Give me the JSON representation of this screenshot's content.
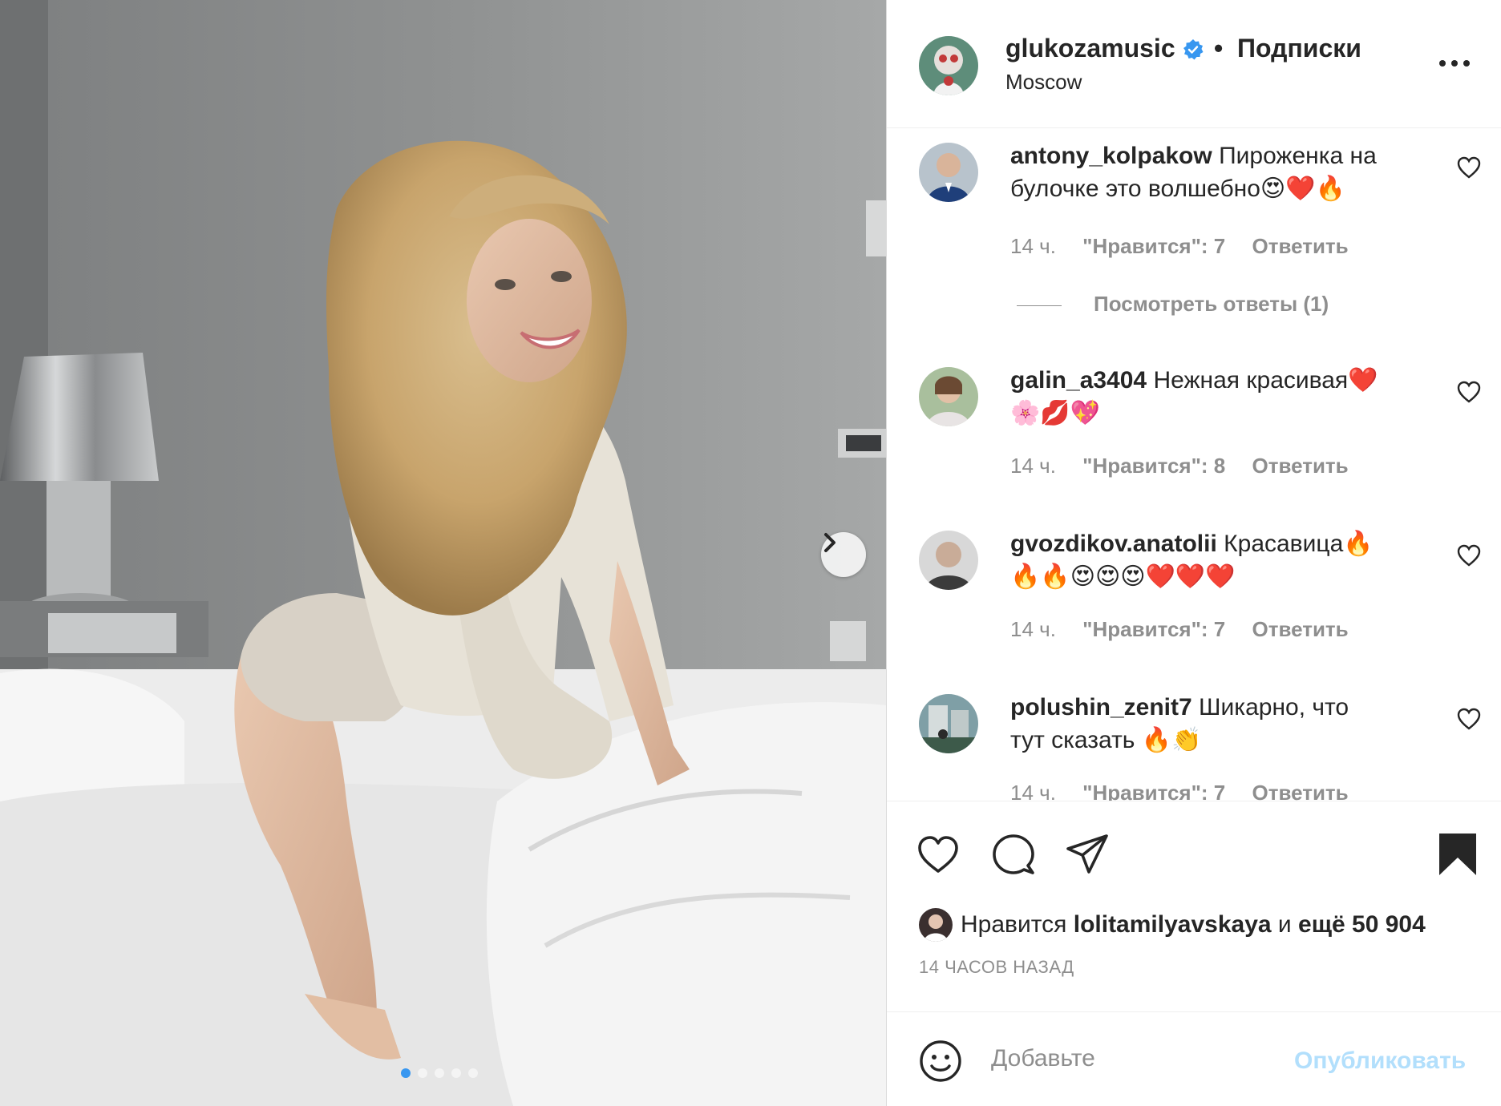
{
  "colors": {
    "accent": "#3897f0",
    "muted": "#8e8e8e",
    "text": "#262626",
    "publish_disabled": "#b2dffc"
  },
  "photo": {
    "carousel_total": 5,
    "carousel_active": 1
  },
  "header": {
    "username": "glukozamusic",
    "verified_icon": "verified-badge-icon",
    "separator": "•",
    "follow_label": "Подписки",
    "location": "Moscow"
  },
  "comments": [
    {
      "username": "antony_kolpakow",
      "text": "Пироженка на булочке это волшебно😍❤️🔥",
      "time": "14 ч.",
      "likes": "\"Нравится\": 7",
      "reply": "Ответить"
    },
    {
      "username": "galin_a3404",
      "text": "Нежная красивая❤️🌸💋💖",
      "time": "14 ч.",
      "likes": "\"Нравится\": 8",
      "reply": "Ответить"
    },
    {
      "username": "gvozdikov.anatolii",
      "text": "Красавица🔥🔥🔥😍😍😍❤️❤️❤️",
      "time": "14 ч.",
      "likes": "\"Нравится\": 7",
      "reply": "Ответить"
    },
    {
      "username": "polushin_zenit7",
      "text": "Шикарно, что тут сказать 🔥👏",
      "time": "14 ч.",
      "likes": "\"Нравится\": 7",
      "reply": "Ответить"
    }
  ],
  "view_replies": "Посмотреть ответы (1)",
  "likes": {
    "prefix": "Нравится",
    "user": "lolitamilyavskaya",
    "middle": "и",
    "rest": "ещё 50 904"
  },
  "timestamp": "14 ЧАСОВ НАЗАД",
  "add_comment": {
    "placeholder": "Добавьте",
    "publish": "Опубликовать"
  }
}
